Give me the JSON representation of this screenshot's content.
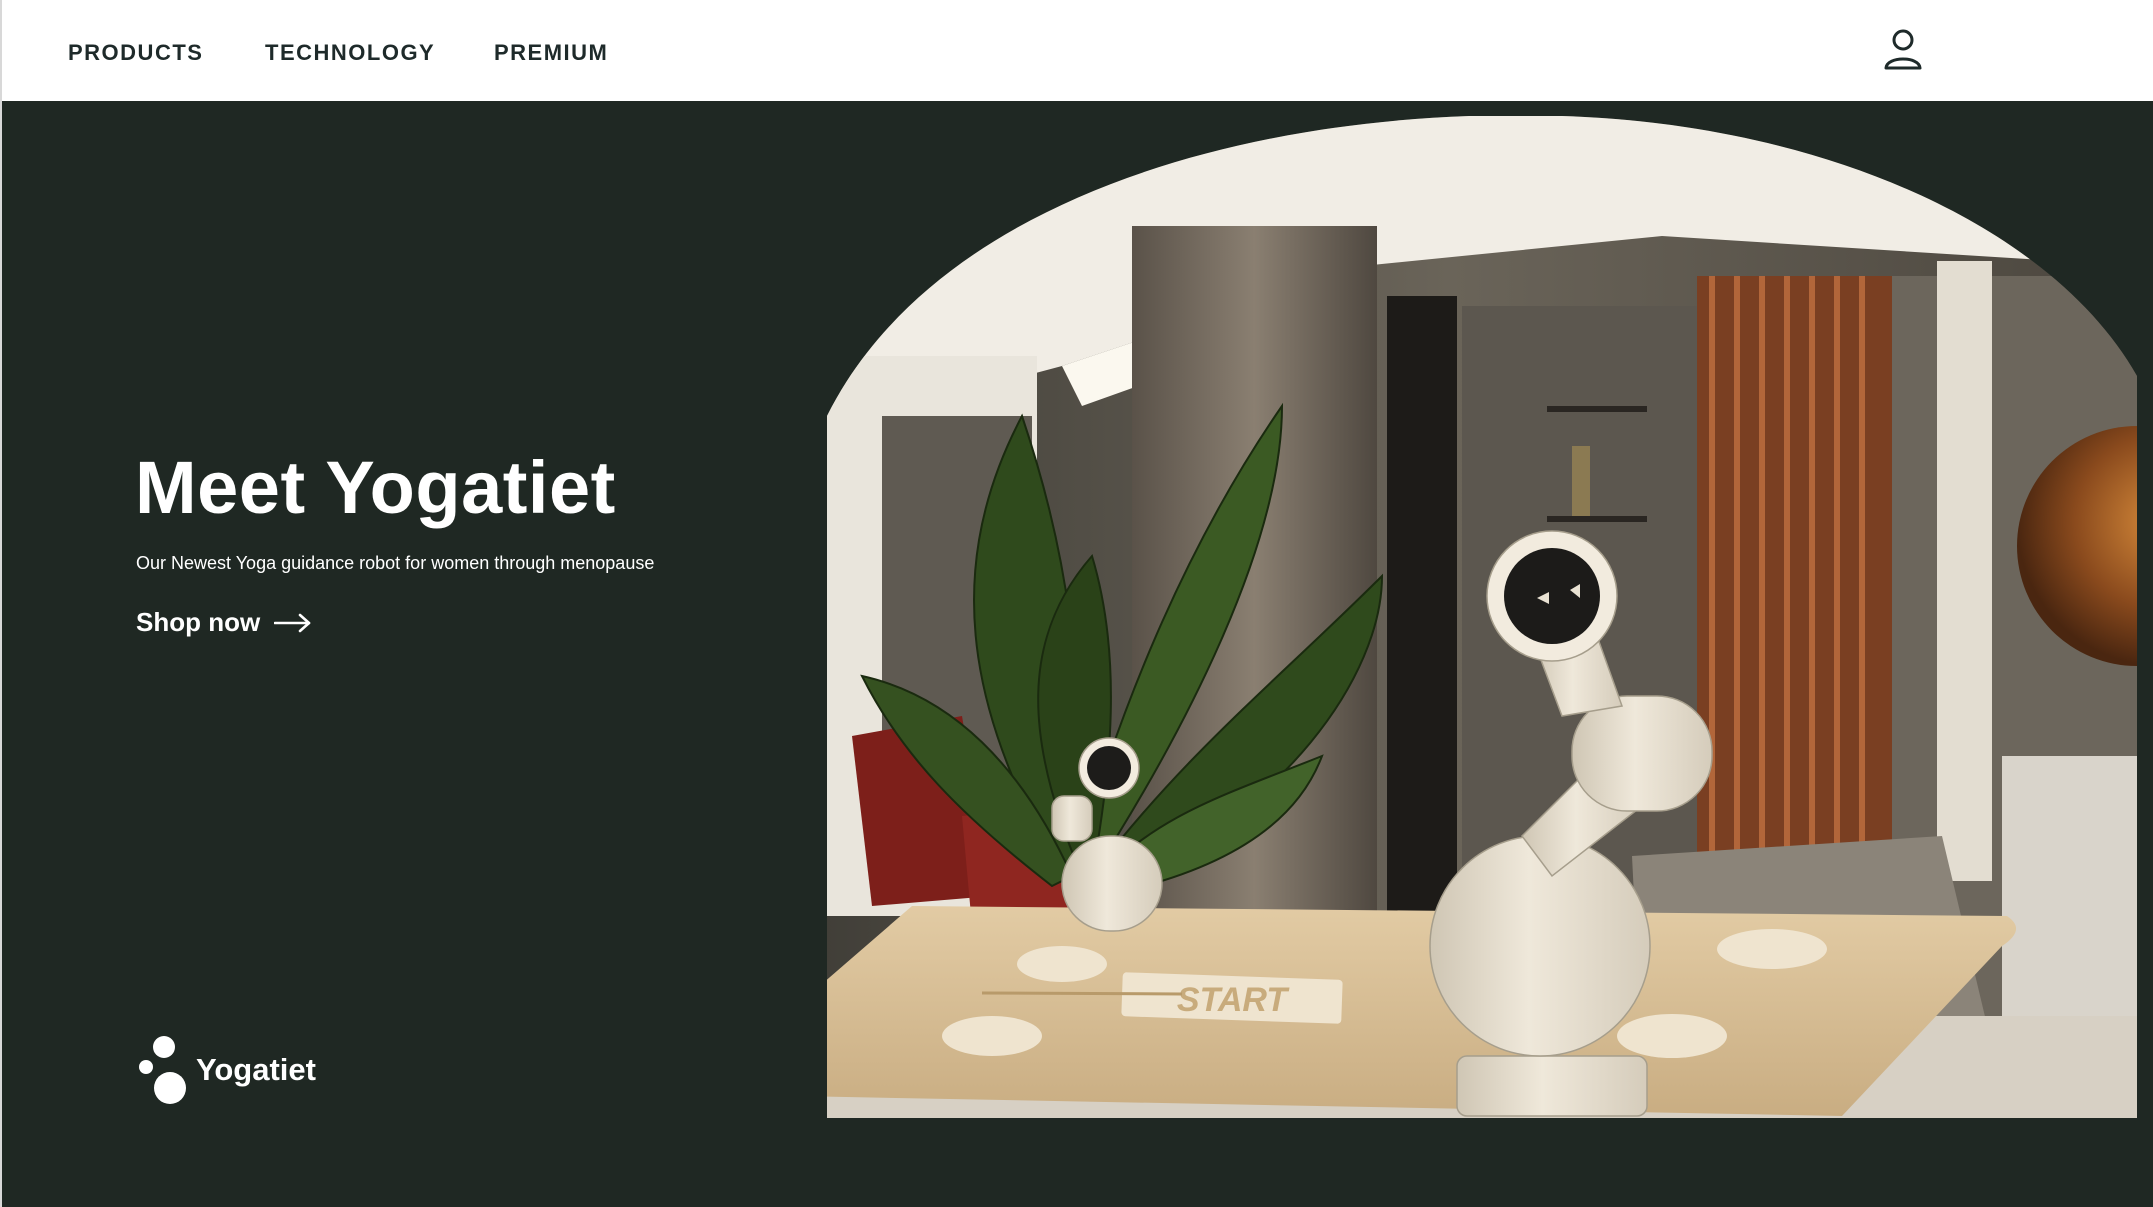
{
  "nav": {
    "links": [
      {
        "label": "PRODUCTS"
      },
      {
        "label": "TECHNOLOGY"
      },
      {
        "label": "PREMIUM"
      }
    ],
    "account_icon": "user-icon"
  },
  "hero": {
    "title": "Meet Yogatiet",
    "subtitle": "Our Newest Yoga guidance robot for women through menopause",
    "cta_label": "Shop now",
    "cta_icon": "arrow-right-icon",
    "mat_label": "START"
  },
  "footer_logo": {
    "text": "Yogatiet",
    "icon": "yogatiet-logo-icon"
  },
  "colors": {
    "hero_background": "#1f2823",
    "nav_text": "#1e2a2a",
    "mat": "#d9bf96",
    "robot": "#e9e2d3"
  }
}
